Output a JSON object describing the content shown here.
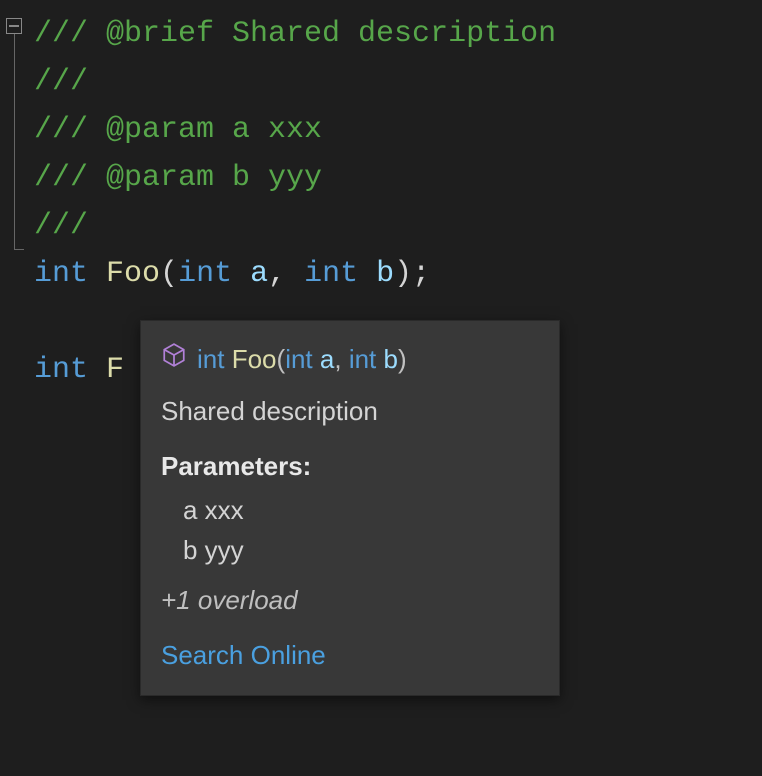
{
  "code": {
    "lines": [
      {
        "segments": [
          {
            "cls": "tk-comment",
            "text": "/// @brief Shared description"
          }
        ]
      },
      {
        "segments": [
          {
            "cls": "tk-comment",
            "text": "///"
          }
        ]
      },
      {
        "segments": [
          {
            "cls": "tk-comment",
            "text": "/// @param a xxx"
          }
        ]
      },
      {
        "segments": [
          {
            "cls": "tk-comment",
            "text": "/// @param b yyy"
          }
        ]
      },
      {
        "segments": [
          {
            "cls": "tk-comment",
            "text": "///"
          }
        ]
      },
      {
        "segments": [
          {
            "cls": "tk-keyword",
            "text": "int"
          },
          {
            "cls": "tk-plain",
            "text": " "
          },
          {
            "cls": "tk-func",
            "text": "Foo"
          },
          {
            "cls": "tk-plain",
            "text": "("
          },
          {
            "cls": "tk-keyword",
            "text": "int"
          },
          {
            "cls": "tk-plain",
            "text": " "
          },
          {
            "cls": "tk-param",
            "text": "a"
          },
          {
            "cls": "tk-plain",
            "text": ", "
          },
          {
            "cls": "tk-keyword",
            "text": "int"
          },
          {
            "cls": "tk-plain",
            "text": " "
          },
          {
            "cls": "tk-param",
            "text": "b"
          },
          {
            "cls": "tk-plain",
            "text": ");"
          }
        ]
      },
      {
        "segments": [
          {
            "cls": "tk-plain",
            "text": " "
          }
        ]
      },
      {
        "segments": [
          {
            "cls": "tk-keyword",
            "text": "int"
          },
          {
            "cls": "tk-plain",
            "text": " "
          },
          {
            "cls": "tk-func",
            "text": "F"
          }
        ]
      }
    ]
  },
  "tooltip": {
    "icon": "cube-icon",
    "signature": {
      "ret_kw": "int",
      "space1": " ",
      "name": "Foo",
      "lparen": "(",
      "p1_kw": "int",
      "p1_sp": " ",
      "p1_nm": "a",
      "comma": ", ",
      "p2_kw": "int",
      "p2_sp": " ",
      "p2_nm": "b",
      "rparen": ")"
    },
    "description": "Shared description",
    "params_heading": "Parameters:",
    "params": [
      {
        "name": "a",
        "desc": "xxx"
      },
      {
        "name": "b",
        "desc": "yyy"
      }
    ],
    "overload_text": "+1 overload",
    "search_label": "Search Online"
  },
  "colors": {
    "bg": "#1e1e1e",
    "tooltip_bg": "#383838",
    "comment": "#57a64a",
    "keyword": "#569cd6",
    "function": "#dcdcaa",
    "param": "#9cdcfe",
    "link": "#4aa0e0"
  }
}
